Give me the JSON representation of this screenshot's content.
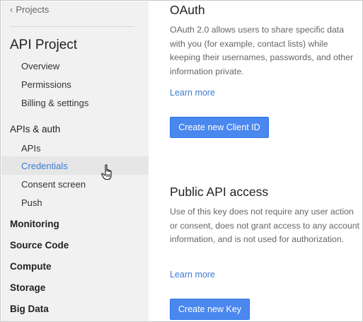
{
  "sidebar": {
    "back_label": "Projects",
    "project_name": "API Project",
    "project_items": [
      {
        "label": "Overview"
      },
      {
        "label": "Permissions"
      },
      {
        "label": "Billing & settings"
      }
    ],
    "apis_auth": {
      "label": "APIs & auth",
      "items": [
        {
          "label": "APIs"
        },
        {
          "label": "Credentials",
          "active": true
        },
        {
          "label": "Consent screen"
        },
        {
          "label": "Push"
        }
      ]
    },
    "sections": [
      {
        "label": "Monitoring"
      },
      {
        "label": "Source Code"
      },
      {
        "label": "Compute"
      },
      {
        "label": "Storage"
      },
      {
        "label": "Big Data"
      }
    ]
  },
  "oauth": {
    "title": "OAuth",
    "description": "OAuth 2.0 allows users to share specific data with you (for example, contact lists) while keeping their usernames, passwords, and other information private.",
    "learn_more": "Learn more",
    "button": "Create new Client ID"
  },
  "public_api": {
    "title": "Public API access",
    "description": "Use of this key does not require any user action or consent, does not grant access to any account information, and is not used for authorization.",
    "learn_more": "Learn more",
    "button": "Create new Key"
  },
  "colors": {
    "accent": "#4a87ee",
    "link": "#3b7bd4",
    "sidebar_bg": "#f1f1f1",
    "active_bg": "#e6e6e6"
  }
}
